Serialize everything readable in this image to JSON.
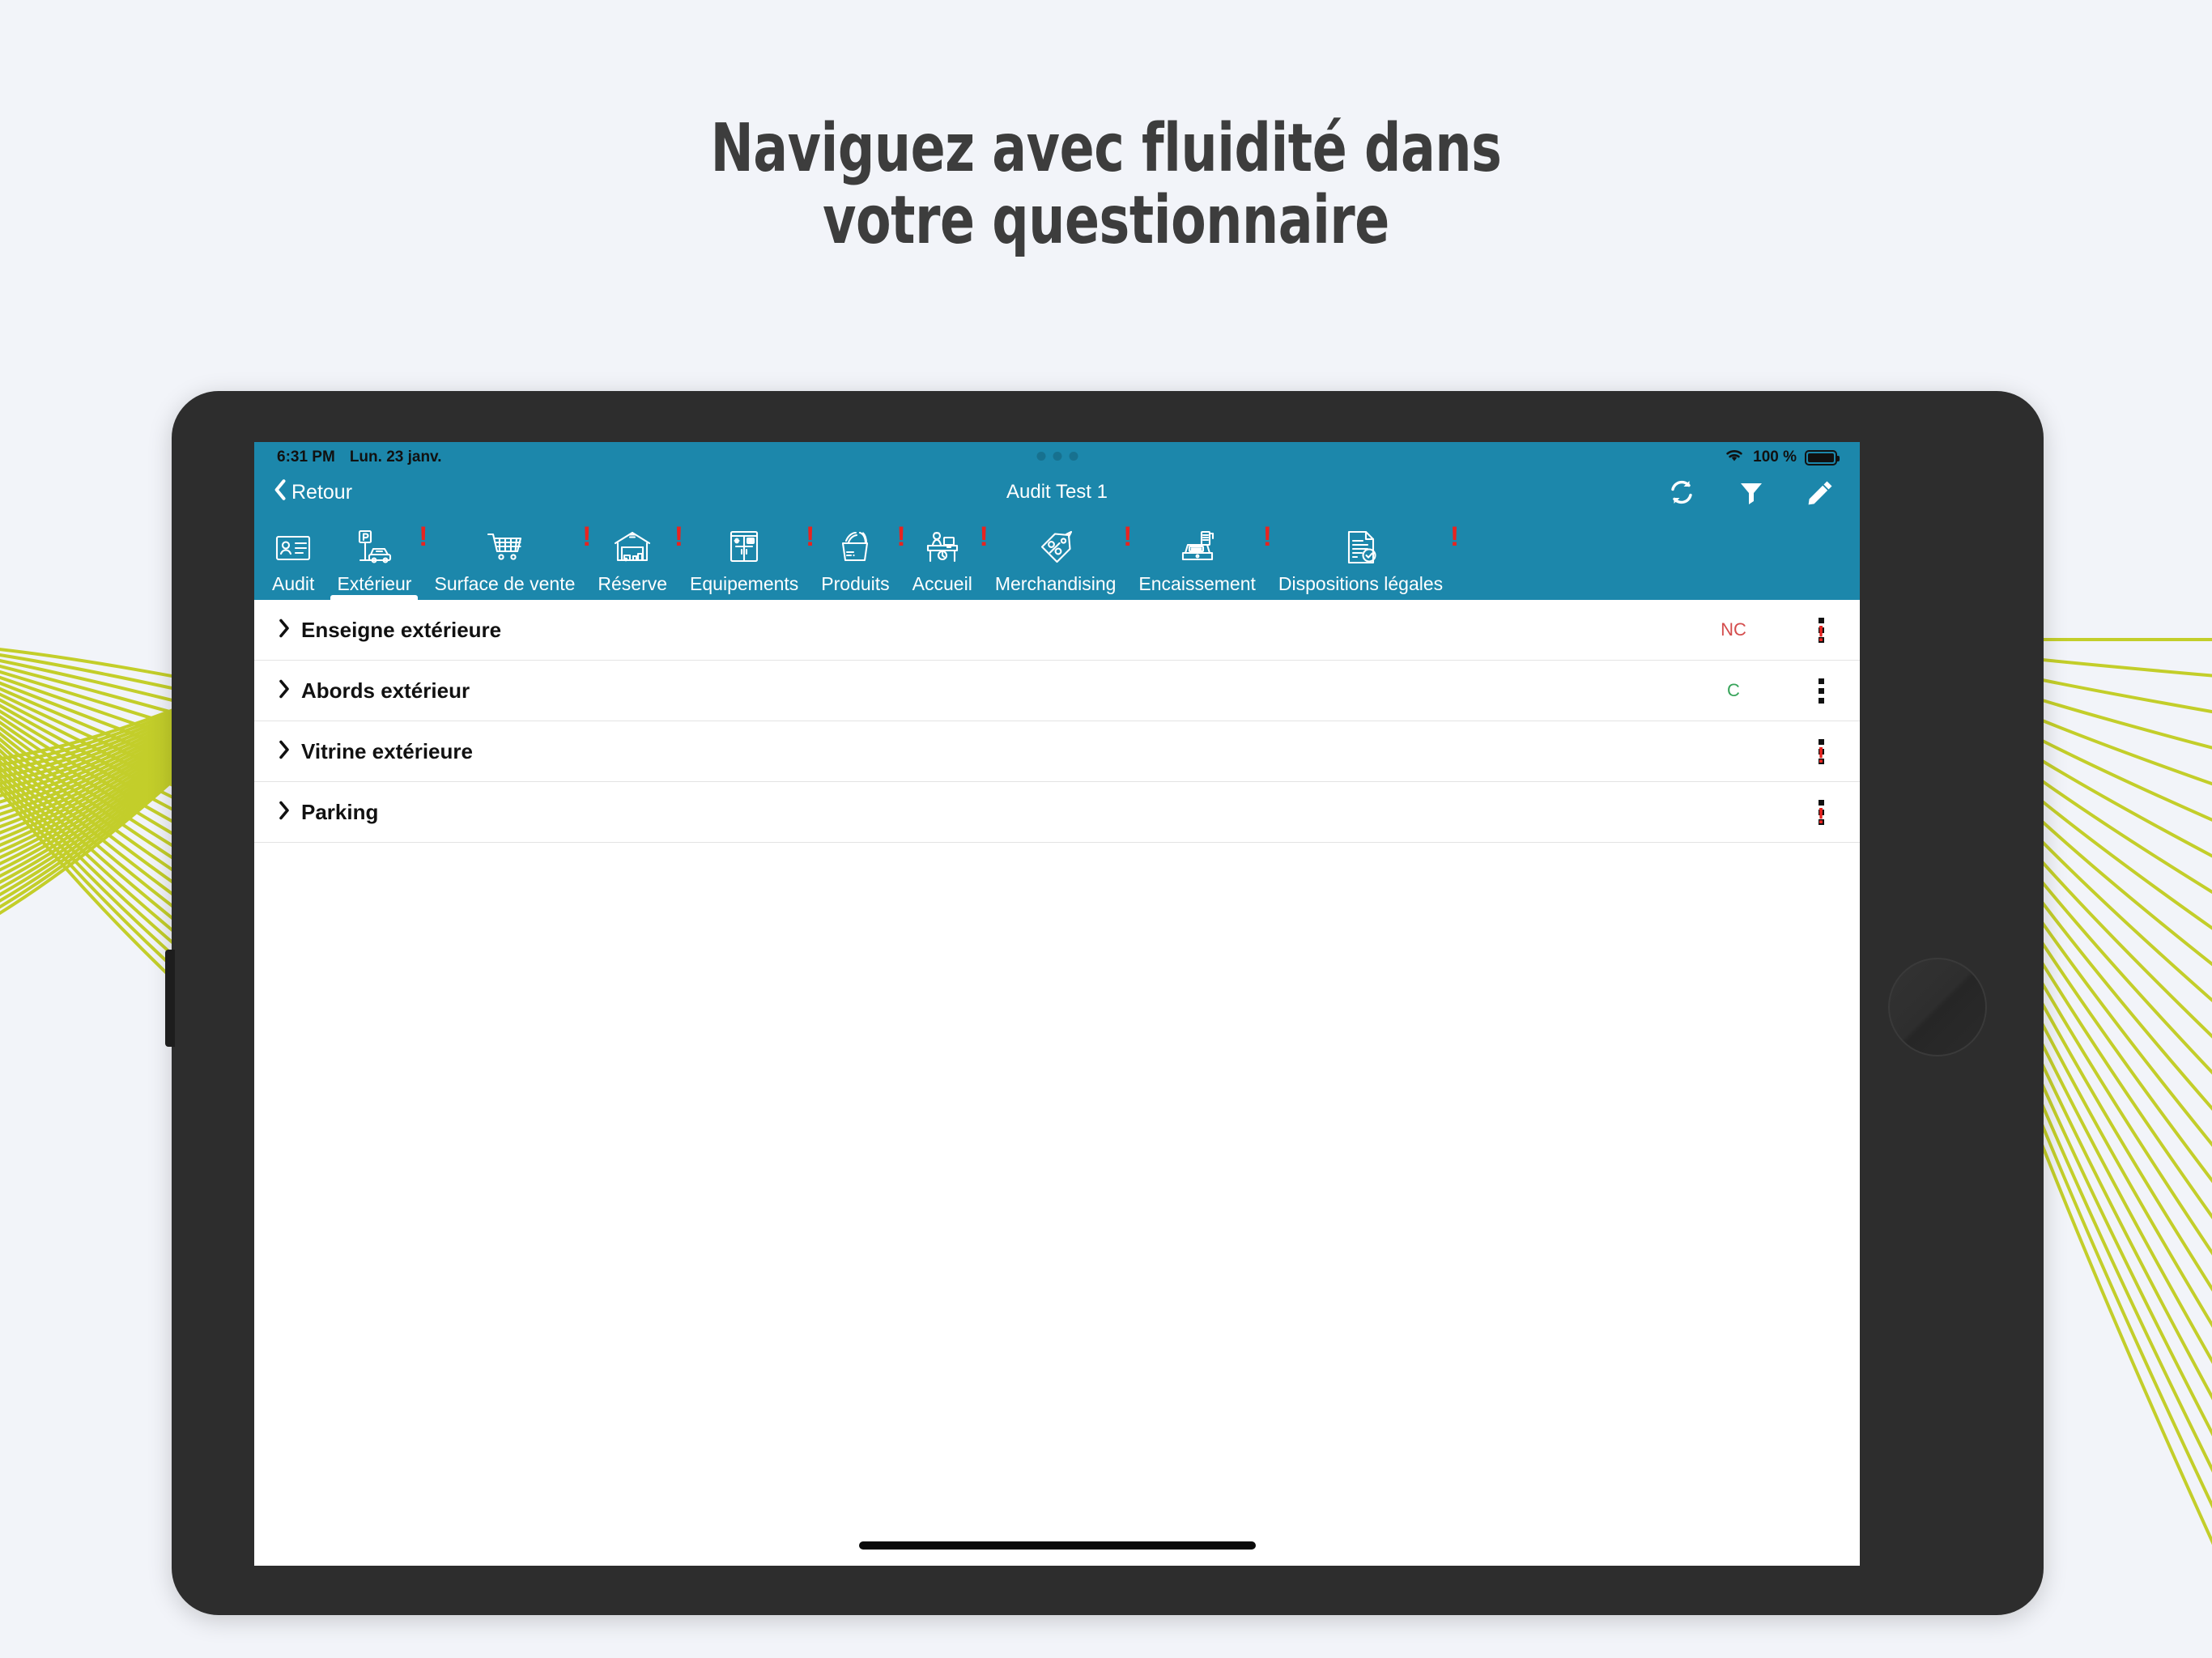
{
  "theme": {
    "accent": "#1c87ab",
    "page_background": "#f2f4f9",
    "wave_color": "#c3ce2a",
    "bezel": "#2d2d2d",
    "alert_red": "#e8231f",
    "status_nc_color": "#d44d4d",
    "status_c_color": "#37a45a",
    "heading_color": "#3d3d3d"
  },
  "headline": {
    "line1": "Naviguez avec fluidité dans",
    "line2": "votre questionnaire"
  },
  "status_bar": {
    "time": "6:31 PM",
    "date": "Lun. 23 janv.",
    "wifi_icon": "wifi-icon",
    "battery_percent": "100 %",
    "battery_icon": "battery-full-icon",
    "multitask_handle": "multitask-dots-handle"
  },
  "nav_bar": {
    "back_label": "Retour",
    "back_icon": "chevron-left-icon",
    "title": "Audit Test 1",
    "actions": [
      {
        "name": "sync-button",
        "icon": "refresh-sync-icon"
      },
      {
        "name": "filter-button",
        "icon": "funnel-filter-icon"
      },
      {
        "name": "edit-button",
        "icon": "pencil-edit-icon"
      }
    ]
  },
  "tabs": [
    {
      "label": "Audit",
      "icon": "id-card-icon",
      "alert": false,
      "active": false
    },
    {
      "label": "Extérieur",
      "icon": "parking-car-icon",
      "alert": true,
      "active": true
    },
    {
      "label": "Surface de vente",
      "icon": "shopping-cart-icon",
      "alert": true,
      "active": false
    },
    {
      "label": "Réserve",
      "icon": "warehouse-icon",
      "alert": true,
      "active": false
    },
    {
      "label": "Equipements",
      "icon": "fridge-cabinet-icon",
      "alert": true,
      "active": false
    },
    {
      "label": "Produits",
      "icon": "grocery-basket-icon",
      "alert": true,
      "active": false
    },
    {
      "label": "Accueil",
      "icon": "reception-desk-icon",
      "alert": true,
      "active": false
    },
    {
      "label": "Merchandising",
      "icon": "price-tag-percent-icon",
      "alert": true,
      "active": false
    },
    {
      "label": "Encaissement",
      "icon": "cash-register-icon",
      "alert": true,
      "active": false
    },
    {
      "label": "Dispositions légales",
      "icon": "document-check-icon",
      "alert": true,
      "active": false
    }
  ],
  "alert_glyph": "!",
  "list": {
    "chevron_icon": "chevron-right-icon",
    "menu_icon": "more-vertical-icon",
    "rows": [
      {
        "title": "Enseigne extérieure",
        "status": "NC",
        "status_kind": "nc",
        "alert": true
      },
      {
        "title": "Abords extérieur",
        "status": "C",
        "status_kind": "c",
        "alert": false
      },
      {
        "title": "Vitrine extérieure",
        "status": "",
        "status_kind": "none",
        "alert": true
      },
      {
        "title": "Parking",
        "status": "",
        "status_kind": "none",
        "alert": true
      }
    ]
  }
}
